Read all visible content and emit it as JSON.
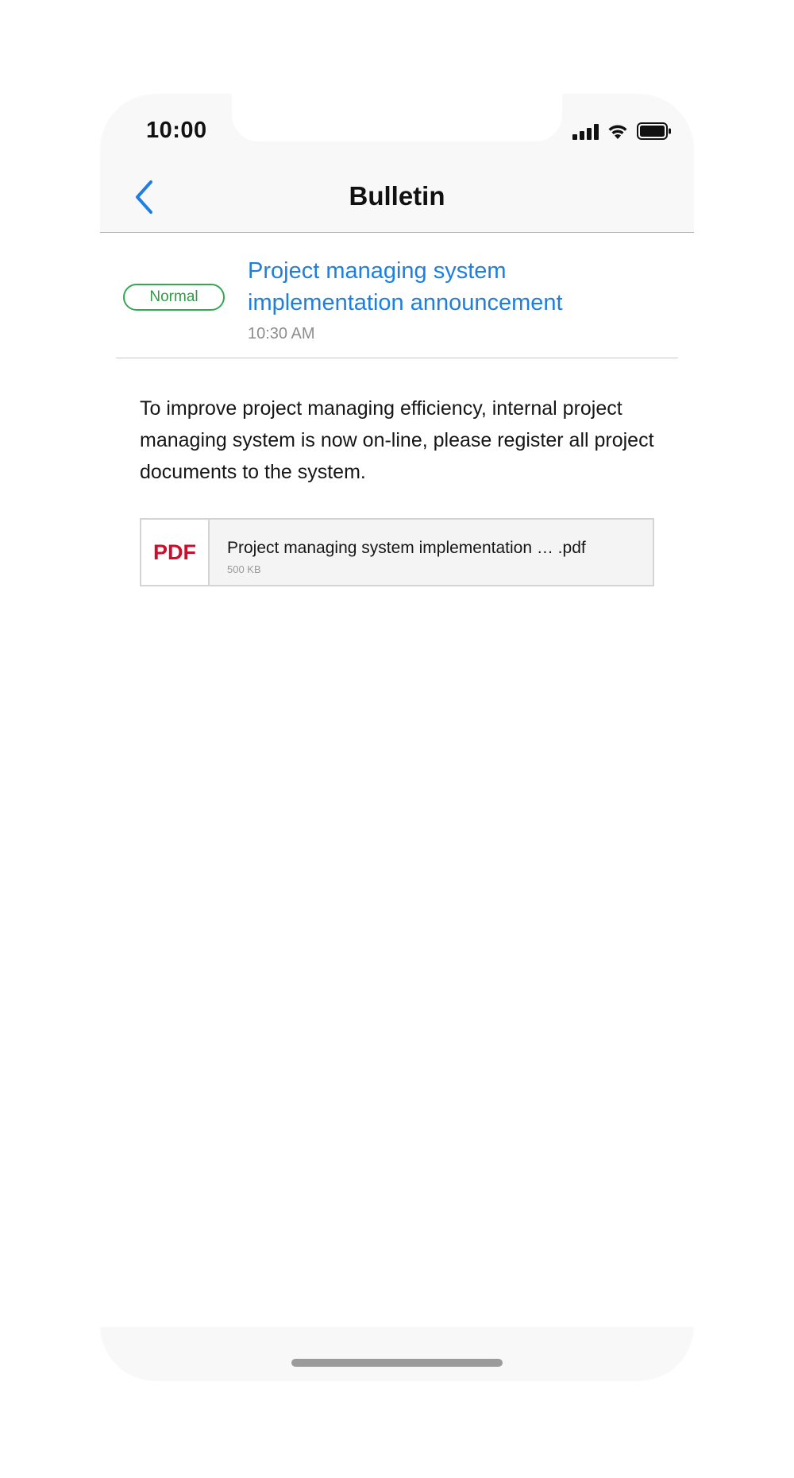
{
  "status_bar": {
    "time": "10:00",
    "icons": [
      "cellular-signal-icon",
      "wifi-icon",
      "battery-icon"
    ]
  },
  "nav": {
    "back_icon": "chevron-left-icon",
    "title": "Bulletin"
  },
  "bulletin": {
    "priority": "Normal",
    "title": "Project managing system implementation announcement",
    "time": "10:30 AM",
    "body": "To improve project managing efficiency, internal project managing system is now on-line, please register all project documents to the system."
  },
  "attachment": {
    "type_label": "PDF",
    "name": "Project managing system implementation … .pdf",
    "size": "500 KB"
  },
  "colors": {
    "accent": "#1f7fe0",
    "priority_normal": "#34a853",
    "pdf": "#c8102e"
  }
}
